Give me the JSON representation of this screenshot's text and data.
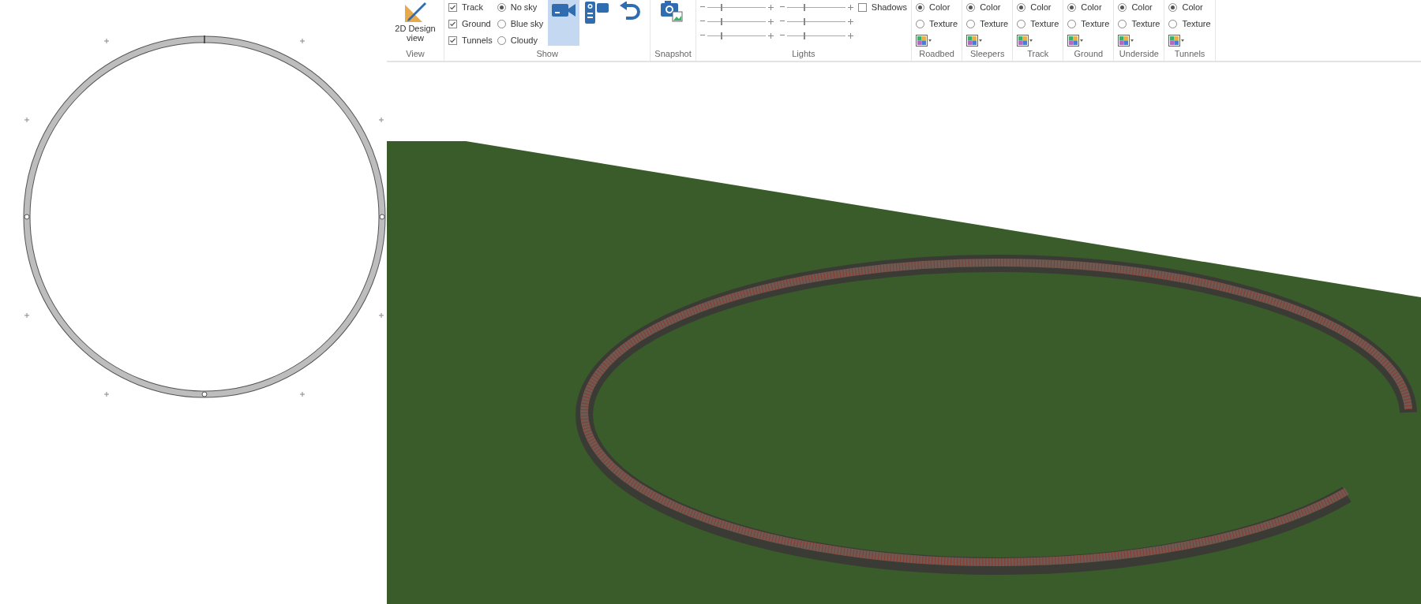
{
  "ribbon": {
    "groups": [
      {
        "kind": "view",
        "label": "View",
        "button": {
          "label": "2D Design view"
        }
      },
      {
        "kind": "show",
        "label": "Show",
        "checkboxes": [
          {
            "label": "Track",
            "checked": true
          },
          {
            "label": "Ground",
            "checked": true
          },
          {
            "label": "Tunnels",
            "checked": true
          }
        ],
        "sky": [
          {
            "label": "No sky",
            "selected": true
          },
          {
            "label": "Blue sky",
            "selected": false
          },
          {
            "label": "Cloudy",
            "selected": false
          }
        ],
        "tools": [
          {
            "kind": "camera",
            "selected": true
          },
          {
            "kind": "camcorder",
            "selected": false
          },
          {
            "kind": "undo",
            "selected": false
          }
        ]
      },
      {
        "kind": "snapshot",
        "label": "Snapshot"
      },
      {
        "kind": "lights",
        "label": "Lights",
        "sliders": [
          {
            "level": 0.25
          },
          {
            "level": 0.3
          },
          {
            "level": 0.25
          },
          {
            "level": 0.3
          },
          {
            "level": 0.25
          },
          {
            "level": 0.3
          }
        ],
        "shadows": {
          "label": "Shadows",
          "checked": false
        }
      },
      {
        "kind": "material",
        "label": "Roadbed",
        "options": [
          {
            "label": "Color",
            "selected": true
          },
          {
            "label": "Texture",
            "selected": false
          }
        ]
      },
      {
        "kind": "material",
        "label": "Sleepers",
        "options": [
          {
            "label": "Color",
            "selected": true
          },
          {
            "label": "Texture",
            "selected": false
          }
        ]
      },
      {
        "kind": "material",
        "label": "Track",
        "options": [
          {
            "label": "Color",
            "selected": true
          },
          {
            "label": "Texture",
            "selected": false
          }
        ]
      },
      {
        "kind": "material",
        "label": "Ground",
        "options": [
          {
            "label": "Color",
            "selected": true
          },
          {
            "label": "Texture",
            "selected": false
          }
        ]
      },
      {
        "kind": "material",
        "label": "Underside",
        "options": [
          {
            "label": "Color",
            "selected": true
          },
          {
            "label": "Texture",
            "selected": false
          }
        ]
      },
      {
        "kind": "material",
        "label": "Tunnels",
        "options": [
          {
            "label": "Color",
            "selected": true
          },
          {
            "label": "Texture",
            "selected": false
          }
        ]
      }
    ]
  }
}
